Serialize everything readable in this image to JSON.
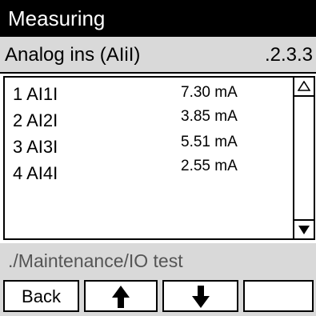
{
  "header": {
    "title": "Measuring"
  },
  "subheader": {
    "title": "Analog ins (AIiI)",
    "menu_code": ".2.3.3"
  },
  "list": {
    "rows": [
      {
        "name": "1 AI1I",
        "value": "7.30 mA"
      },
      {
        "name": "2 AI2I",
        "value": "3.85 mA"
      },
      {
        "name": "3 AI3I",
        "value": "5.51 mA"
      },
      {
        "name": "4 AI4I",
        "value": "2.55 mA"
      }
    ]
  },
  "breadcrumb": "./Maintenance/IO test",
  "softkeys": {
    "back_label": "Back",
    "up_icon": "arrow-up-icon",
    "down_icon": "arrow-down-icon"
  }
}
